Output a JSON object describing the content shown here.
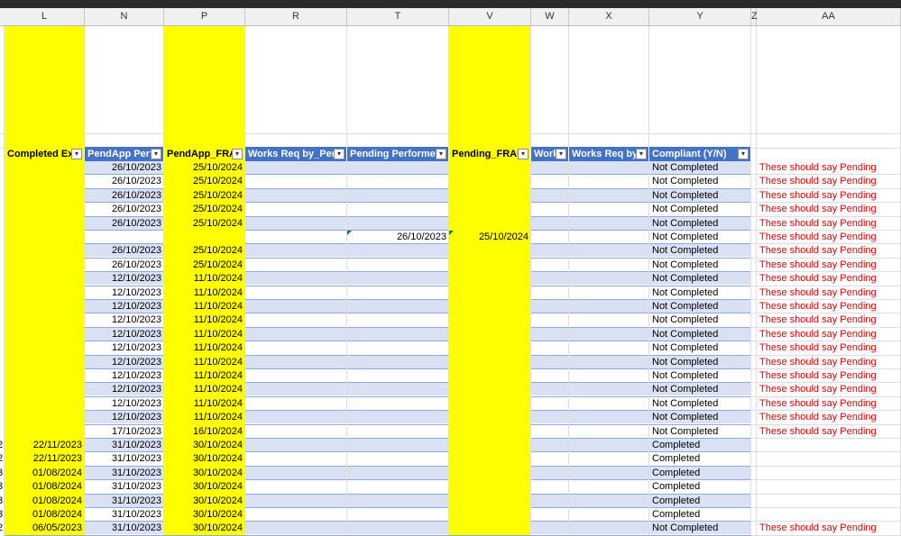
{
  "colors": {
    "highlight": "#ffff00",
    "table_header": "#4472c4",
    "band": "#d9e1f2",
    "note": "#e00000",
    "ribbon": "#2b2b2b"
  },
  "column_headers": [
    "L",
    "N",
    "P",
    "R",
    "T",
    "V",
    "W",
    "X",
    "Y",
    "Z",
    "AA"
  ],
  "table_headers": [
    "Completed Exp",
    "PendApp Perfo",
    "PendApp_FRA",
    "Works Req by_Pend",
    "Pending Performed",
    "Pending_FRAEx",
    "Work",
    "Works Req by_",
    "Compliant (Y/N)"
  ],
  "filter_icon": "dropdown-arrow",
  "rows": [
    {
      "completed_exp": "",
      "pendapp_perf": "26/10/2023",
      "pendapp_fra": "25/10/2024",
      "pending_performed": "",
      "pending_fraex": "",
      "compliant": "Not Completed",
      "note": "These should say Pending"
    },
    {
      "completed_exp": "",
      "pendapp_perf": "26/10/2023",
      "pendapp_fra": "25/10/2024",
      "pending_performed": "",
      "pending_fraex": "",
      "compliant": "Not Completed",
      "note": "These should say Pending"
    },
    {
      "completed_exp": "",
      "pendapp_perf": "26/10/2023",
      "pendapp_fra": "25/10/2024",
      "pending_performed": "",
      "pending_fraex": "",
      "compliant": "Not Completed",
      "note": "These should say Pending"
    },
    {
      "completed_exp": "",
      "pendapp_perf": "26/10/2023",
      "pendapp_fra": "25/10/2024",
      "pending_performed": "",
      "pending_fraex": "",
      "compliant": "Not Completed",
      "note": "These should say Pending"
    },
    {
      "completed_exp": "",
      "pendapp_perf": "26/10/2023",
      "pendapp_fra": "25/10/2024",
      "pending_performed": "",
      "pending_fraex": "",
      "compliant": "Not Completed",
      "note": "These should say Pending"
    },
    {
      "completed_exp": "",
      "pendapp_perf": "",
      "pendapp_fra": "",
      "pending_performed": "26/10/2023",
      "pending_fraex": "25/10/2024",
      "compliant": "Not Completed",
      "note": "These should say Pending"
    },
    {
      "completed_exp": "",
      "pendapp_perf": "26/10/2023",
      "pendapp_fra": "25/10/2024",
      "pending_performed": "",
      "pending_fraex": "",
      "compliant": "Not Completed",
      "note": "These should say Pending"
    },
    {
      "completed_exp": "",
      "pendapp_perf": "26/10/2023",
      "pendapp_fra": "25/10/2024",
      "pending_performed": "",
      "pending_fraex": "",
      "compliant": "Not Completed",
      "note": "These should say Pending"
    },
    {
      "completed_exp": "",
      "pendapp_perf": "12/10/2023",
      "pendapp_fra": "11/10/2024",
      "pending_performed": "",
      "pending_fraex": "",
      "compliant": "Not Completed",
      "note": "These should say Pending"
    },
    {
      "completed_exp": "",
      "pendapp_perf": "12/10/2023",
      "pendapp_fra": "11/10/2024",
      "pending_performed": "",
      "pending_fraex": "",
      "compliant": "Not Completed",
      "note": "These should say Pending"
    },
    {
      "completed_exp": "",
      "pendapp_perf": "12/10/2023",
      "pendapp_fra": "11/10/2024",
      "pending_performed": "",
      "pending_fraex": "",
      "compliant": "Not Completed",
      "note": "These should say Pending"
    },
    {
      "completed_exp": "",
      "pendapp_perf": "12/10/2023",
      "pendapp_fra": "11/10/2024",
      "pending_performed": "",
      "pending_fraex": "",
      "compliant": "Not Completed",
      "note": "These should say Pending"
    },
    {
      "completed_exp": "",
      "pendapp_perf": "12/10/2023",
      "pendapp_fra": "11/10/2024",
      "pending_performed": "",
      "pending_fraex": "",
      "compliant": "Not Completed",
      "note": "These should say Pending"
    },
    {
      "completed_exp": "",
      "pendapp_perf": "12/10/2023",
      "pendapp_fra": "11/10/2024",
      "pending_performed": "",
      "pending_fraex": "",
      "compliant": "Not Completed",
      "note": "These should say Pending"
    },
    {
      "completed_exp": "",
      "pendapp_perf": "12/10/2023",
      "pendapp_fra": "11/10/2024",
      "pending_performed": "",
      "pending_fraex": "",
      "compliant": "Not Completed",
      "note": "These should say Pending"
    },
    {
      "completed_exp": "",
      "pendapp_perf": "12/10/2023",
      "pendapp_fra": "11/10/2024",
      "pending_performed": "",
      "pending_fraex": "",
      "compliant": "Not Completed",
      "note": "These should say Pending"
    },
    {
      "completed_exp": "",
      "pendapp_perf": "12/10/2023",
      "pendapp_fra": "11/10/2024",
      "pending_performed": "",
      "pending_fraex": "",
      "compliant": "Not Completed",
      "note": "These should say Pending"
    },
    {
      "completed_exp": "",
      "pendapp_perf": "12/10/2023",
      "pendapp_fra": "11/10/2024",
      "pending_performed": "",
      "pending_fraex": "",
      "compliant": "Not Completed",
      "note": "These should say Pending"
    },
    {
      "completed_exp": "",
      "pendapp_perf": "12/10/2023",
      "pendapp_fra": "11/10/2024",
      "pending_performed": "",
      "pending_fraex": "",
      "compliant": "Not Completed",
      "note": "These should say Pending"
    },
    {
      "completed_exp": "",
      "pendapp_perf": "17/10/2023",
      "pendapp_fra": "16/10/2024",
      "pending_performed": "",
      "pending_fraex": "",
      "compliant": "Not Completed",
      "note": "These should say Pending"
    },
    {
      "completed_exp": "22/11/2023",
      "pendapp_perf": "31/10/2023",
      "pendapp_fra": "30/10/2024",
      "pending_performed": "",
      "pending_fraex": "",
      "compliant": "Completed",
      "note": ""
    },
    {
      "completed_exp": "22/11/2023",
      "pendapp_perf": "31/10/2023",
      "pendapp_fra": "30/10/2024",
      "pending_performed": "",
      "pending_fraex": "",
      "compliant": "Completed",
      "note": ""
    },
    {
      "completed_exp": "01/08/2024",
      "pendapp_perf": "31/10/2023",
      "pendapp_fra": "30/10/2024",
      "pending_performed": "",
      "pending_fraex": "",
      "compliant": "Completed",
      "note": ""
    },
    {
      "completed_exp": "01/08/2024",
      "pendapp_perf": "31/10/2023",
      "pendapp_fra": "30/10/2024",
      "pending_performed": "",
      "pending_fraex": "",
      "compliant": "Completed",
      "note": ""
    },
    {
      "completed_exp": "01/08/2024",
      "pendapp_perf": "31/10/2023",
      "pendapp_fra": "30/10/2024",
      "pending_performed": "",
      "pending_fraex": "",
      "compliant": "Completed",
      "note": ""
    },
    {
      "completed_exp": "01/08/2024",
      "pendapp_perf": "31/10/2023",
      "pendapp_fra": "30/10/2024",
      "pending_performed": "",
      "pending_fraex": "",
      "compliant": "Completed",
      "note": ""
    },
    {
      "completed_exp": "06/05/2023",
      "pendapp_perf": "31/10/2023",
      "pendapp_fra": "30/10/2024",
      "pending_performed": "",
      "pending_fraex": "",
      "compliant": "Not Completed",
      "note": "These should say Pending"
    }
  ],
  "left_edge_digits": [
    "2",
    "2",
    "3",
    "3",
    "3",
    "3",
    "2"
  ]
}
